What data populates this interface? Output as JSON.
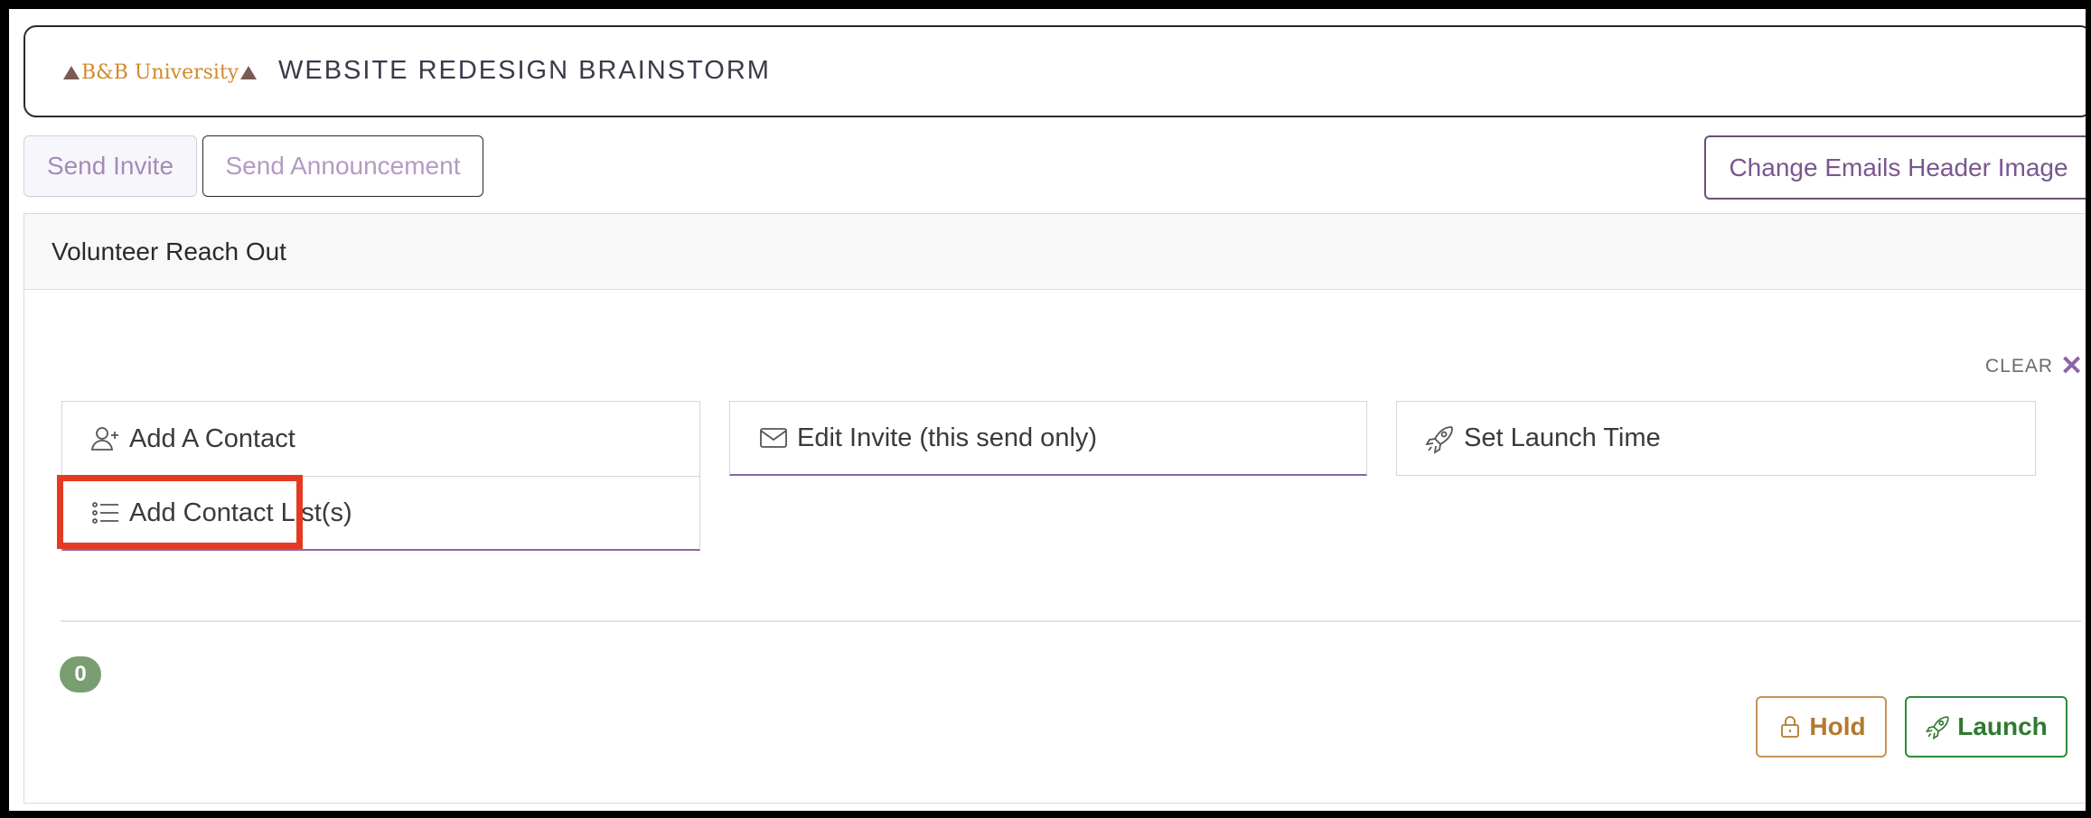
{
  "header": {
    "logo_text": "B&B University",
    "project_title": "WEBSITE REDESIGN BRAINSTORM"
  },
  "toolbar": {
    "send_invite": "Send Invite",
    "send_announcement": "Send Announcement",
    "change_header_image": "Change Emails Header Image"
  },
  "card": {
    "title": "Volunteer Reach Out",
    "clear_label": "CLEAR",
    "options": {
      "add_contact": "Add A Contact",
      "add_contact_lists": "Add Contact List(s)",
      "edit_invite": "Edit Invite (this send only)",
      "set_launch_time": "Set Launch Time"
    },
    "count": "0",
    "hold_label": "Hold",
    "launch_label": "Launch"
  },
  "colors": {
    "accent_purple": "#8b64a8",
    "hold_color": "#b27a2e",
    "launch_color": "#2f7a2f",
    "badge_green": "#7a9e72",
    "highlight_red": "#e53a22"
  }
}
